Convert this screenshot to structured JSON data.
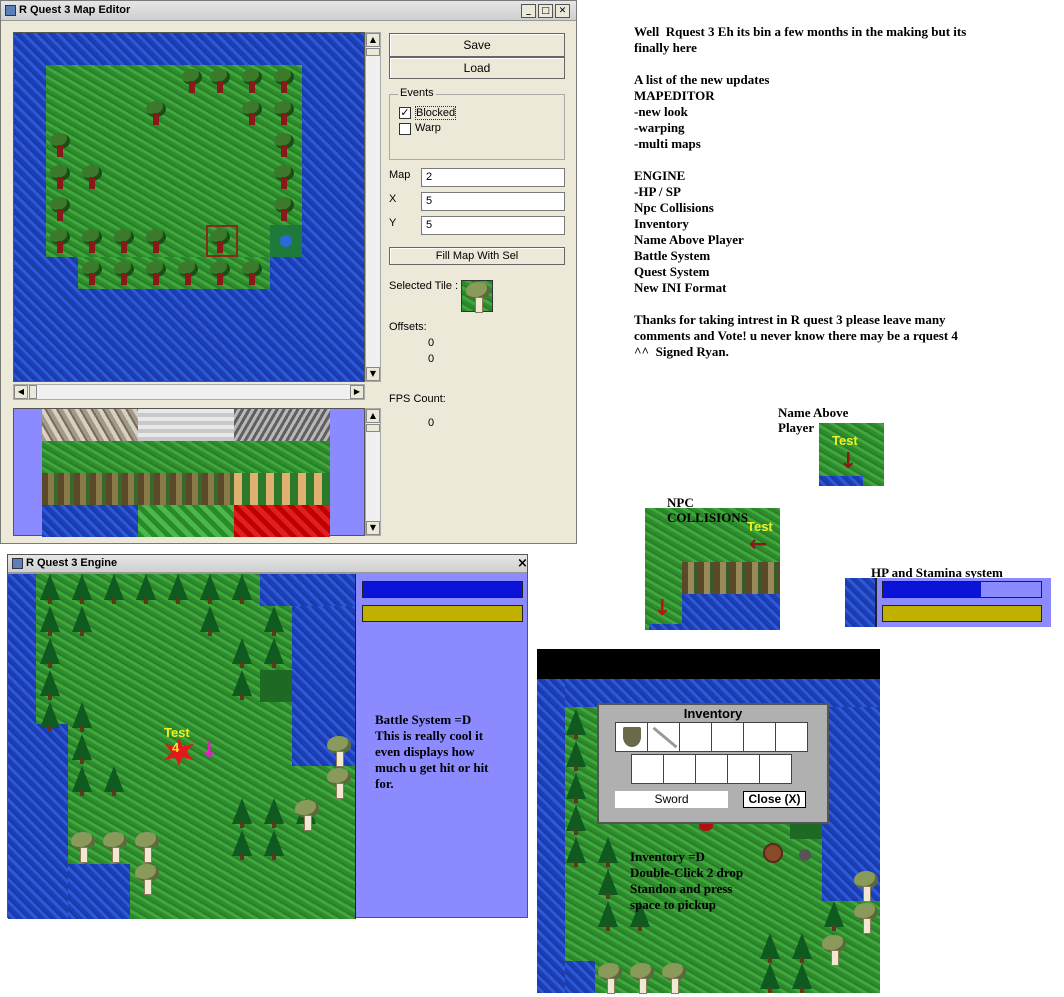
{
  "editor": {
    "title": "R Quest 3 Map Editor",
    "save_label": "Save",
    "load_label": "Load",
    "events_legend": "Events",
    "blocked_label": "Blocked",
    "blocked_checked": true,
    "warp_label": "Warp",
    "warp_checked": false,
    "map_label": "Map",
    "map_value": "2",
    "x_label": "X",
    "x_value": "5",
    "y_label": "Y",
    "y_value": "5",
    "fill_label": "Fill Map With Sel",
    "selected_tile_label": "Selected Tile :",
    "offsets_label": "Offsets:",
    "offset_x": "0",
    "offset_y": "0",
    "fps_label": "FPS Count:",
    "fps_value": "0"
  },
  "engine": {
    "title": "R Quest 3 Engine",
    "close_glyph": "×",
    "battle_name": "Test",
    "battle_hit": "4",
    "battle_text": "Battle System =D\nThis is really cool it\neven displays how\nmuch u get hit or hit\nfor.",
    "hp_fraction": 1.0,
    "sp_fraction": 1.0,
    "hp_color": "#0a14d8",
    "sp_color": "#c0b000"
  },
  "notes": {
    "text": "Well  Rquest 3 Eh its bin a few months in the making but its\nfinally here\n\nA list of the new updates\nMAPEDITOR\n-new look\n-warping\n-multi maps\n\nENGINE\n-HP / SP\nNpc Collisions\nInventory\nName Above Player\nBattle System\nQuest System\nNew INI Format\n\nThanks for taking intrest in R quest 3 please leave many\ncomments and Vote! u never know there may be a rquest 4\n^^  Signed Ryan."
  },
  "name_above": {
    "caption": "Name Above\nPlayer",
    "player_name": "Test"
  },
  "npc": {
    "caption": "NPC\nCOLLISIONS",
    "player_name": "Test"
  },
  "hpsp": {
    "caption": "HP and Stamina system",
    "hp_fraction": 0.62,
    "sp_fraction": 1.0,
    "hp_color": "#0a14d8",
    "sp_color": "#c0b000"
  },
  "inventory": {
    "title": "Inventory",
    "item_name": "Sword",
    "close_label": "Close (X)",
    "text": "Inventory =D\nDouble-Click 2 drop\nStandon and press\nspace to pickup"
  },
  "icons": {
    "arrow": "down-arrow-icon",
    "npc_arrow": "left-arrow-icon"
  }
}
